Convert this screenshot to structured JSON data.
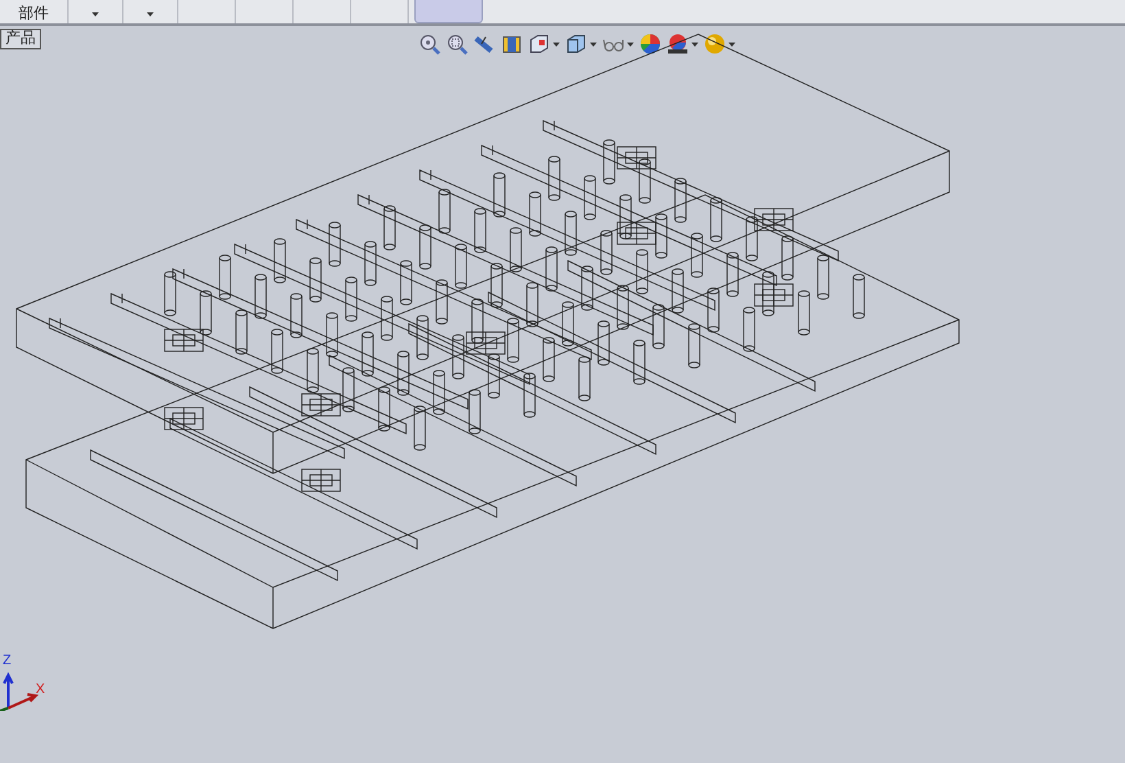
{
  "toolbar": {
    "buttons": [
      {
        "label": "部件",
        "kind": "text"
      },
      {
        "kind": "dropdown"
      },
      {
        "kind": "dropdown"
      },
      {
        "kind": "blank"
      },
      {
        "kind": "blank"
      },
      {
        "kind": "blank"
      },
      {
        "kind": "blank"
      },
      {
        "kind": "selected"
      }
    ]
  },
  "tree_tab": {
    "label": "产品"
  },
  "triad": {
    "z_label": "Z",
    "x_label": "X"
  }
}
